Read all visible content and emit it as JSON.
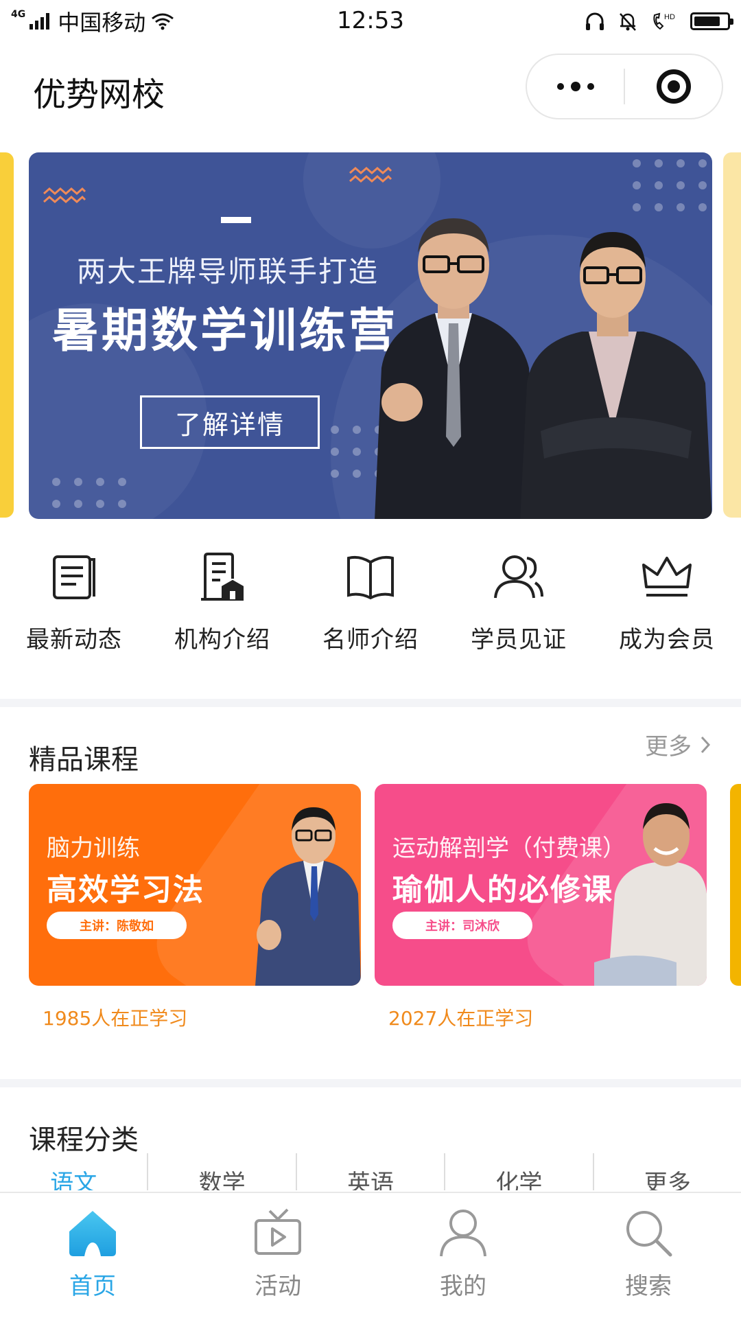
{
  "status_bar": {
    "network": "4G",
    "carrier": "中国移动",
    "time": "12:53",
    "battery_level": 0.8,
    "icons": [
      "signal-icon",
      "wifi-icon",
      "headphones-icon",
      "bell-off-icon",
      "hd-call-icon",
      "battery-icon"
    ]
  },
  "header": {
    "title": "优势网校",
    "capsule_icons": [
      "more-dots-icon",
      "target-close-icon"
    ]
  },
  "banner": {
    "subtitle": "两大王牌导师联手打造",
    "headline": "暑期数学训练营",
    "button": "了解详情",
    "colors": {
      "background": "#3f5497",
      "left_peek": "#f9cf3a",
      "right_peek": "#fbe6a5"
    }
  },
  "quick_nav": [
    {
      "label": "最新动态",
      "icon": "news-icon"
    },
    {
      "label": "机构介绍",
      "icon": "building-icon"
    },
    {
      "label": "名师介绍",
      "icon": "book-icon"
    },
    {
      "label": "学员见证",
      "icon": "users-icon"
    },
    {
      "label": "成为会员",
      "icon": "crown-icon"
    }
  ],
  "featured": {
    "title": "精品课程",
    "more": "更多",
    "courses": [
      {
        "subtitle": "脑力训练",
        "title": "高效学习法",
        "lecturer": "主讲：陈敬如",
        "count": "1985人在正学习",
        "color": "#ff6e0c"
      },
      {
        "subtitle": "运动解剖学（付费课）",
        "title": "瑜伽人的必修课",
        "lecturer": "主讲：司沐欣",
        "count": "2027人在正学习",
        "color": "#f64d8a"
      }
    ]
  },
  "categories": {
    "title": "课程分类",
    "tabs": [
      "语文",
      "数学",
      "英语",
      "化学",
      "更多"
    ],
    "active_index": 0
  },
  "tab_bar": [
    {
      "label": "首页",
      "icon": "home-icon",
      "active": true
    },
    {
      "label": "活动",
      "icon": "tv-icon",
      "active": false
    },
    {
      "label": "我的",
      "icon": "user-icon",
      "active": false
    },
    {
      "label": "搜索",
      "icon": "search-icon",
      "active": false
    }
  ],
  "accent_color": "#2aa6e6"
}
